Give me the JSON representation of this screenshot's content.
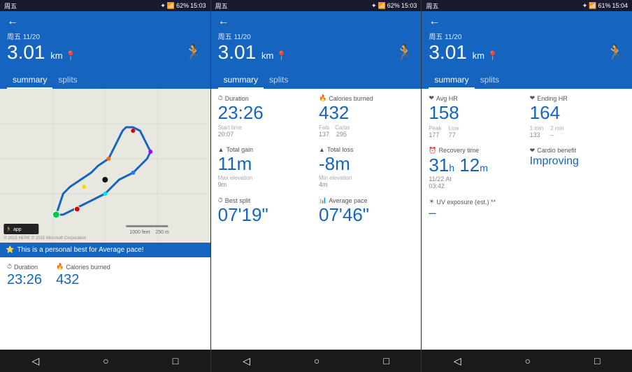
{
  "screens": [
    {
      "statusBar": {
        "left": "周五",
        "bluetooth": "✦",
        "signal": "📶",
        "battery": "62%",
        "time": "15:03"
      },
      "header": {
        "backArrow": "←",
        "date": "周五 11/20",
        "distance": "3.01",
        "distanceUnit": "km",
        "icon": "🏃"
      },
      "tabs": [
        "summary",
        "splits"
      ],
      "activeTab": 0,
      "mapNote": "route map",
      "personalBest": "This is a personal best for Average pace!",
      "stats": [
        {
          "label": "Duration",
          "icon": "⏱",
          "value": "23:26"
        },
        {
          "label": "Calories burned",
          "icon": "🔥",
          "value": "432"
        }
      ]
    },
    {
      "statusBar": {
        "left": "周五",
        "battery": "62%",
        "time": "15:03"
      },
      "header": {
        "backArrow": "←",
        "date": "周五 11/20",
        "distance": "3.01",
        "distanceUnit": "km",
        "icon": "🏃"
      },
      "tabs": [
        "summary",
        "splits"
      ],
      "activeTab": 0,
      "stats": [
        {
          "label": "Duration",
          "icon": "⏱",
          "value": "23:26",
          "subLabel": "Start time",
          "subValue": "20:07"
        },
        {
          "label": "Calories burned",
          "icon": "🔥",
          "value": "432",
          "subLabels": [
            "Fats",
            "Carbs"
          ],
          "subValues": [
            "137",
            "295"
          ]
        },
        {
          "label": "Total gain",
          "icon": "▲",
          "value": "11m",
          "subLabel": "Max elevation",
          "subValue": "9m"
        },
        {
          "label": "Total loss",
          "icon": "▲",
          "value": "-8m",
          "subLabel": "Min elevation",
          "subValue": "4m"
        },
        {
          "label": "Best split",
          "icon": "⏱",
          "value": "07'19\""
        },
        {
          "label": "Average pace",
          "icon": "📊",
          "value": "07'46\""
        }
      ]
    },
    {
      "statusBar": {
        "left": "周五",
        "battery": "61%",
        "time": "15:04"
      },
      "header": {
        "backArrow": "←",
        "date": "周五 11/20",
        "distance": "3.01",
        "distanceUnit": "km",
        "icon": "🏃"
      },
      "tabs": [
        "summary",
        "splits"
      ],
      "activeTab": 0,
      "stats": [
        {
          "label": "Avg HR",
          "icon": "❤",
          "value": "158",
          "subLabels": [
            "Peak",
            "Low"
          ],
          "subValues": [
            "177",
            "77"
          ]
        },
        {
          "label": "Ending HR",
          "icon": "❤",
          "value": "164",
          "subLabels": [
            "1 min",
            "2 min"
          ],
          "subValues": [
            "133",
            "–"
          ]
        },
        {
          "label": "Recovery time",
          "icon": "⏰",
          "value": "31h 12m",
          "subLabel": "11/22 At",
          "subValue": "03:42"
        },
        {
          "label": "Cardio benefit",
          "icon": "❤",
          "value": "Improving",
          "isText": true
        },
        {
          "label": "UV exposure (est.) **",
          "icon": "☀",
          "value": "–"
        }
      ]
    }
  ],
  "bottomNav": [
    "◁",
    "○",
    "□"
  ]
}
